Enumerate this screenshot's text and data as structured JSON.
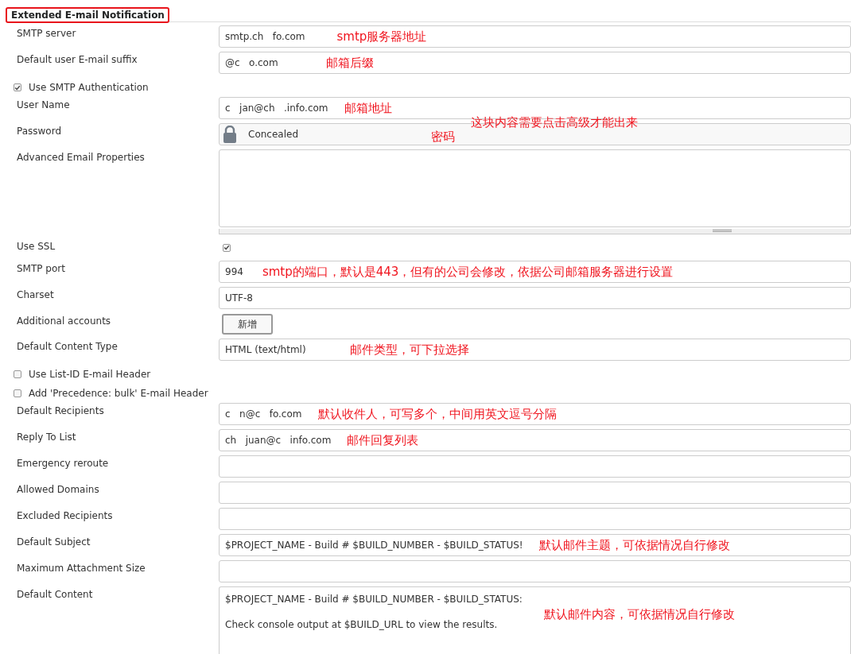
{
  "section": {
    "title": "Extended E-mail Notification"
  },
  "rows": [
    {
      "kind": "text",
      "label": "SMTP server",
      "value": "smtp.ch   fo.com",
      "note": "smtp服务器地址"
    },
    {
      "kind": "text",
      "label": "Default user E-mail suffix",
      "value": "@c   o.com",
      "note": "邮箱后缀"
    },
    {
      "kind": "checkbox",
      "label": "Use SMTP Authentication",
      "checked": true
    },
    {
      "kind": "text",
      "label": "User Name",
      "value": "c   jan@ch   .info.com",
      "note": "邮箱地址"
    },
    {
      "kind": "password",
      "label": "Password",
      "value": "Concealed",
      "note": "密码",
      "overlay_note": "这块内容需要点击高级才能出来"
    },
    {
      "kind": "textarea",
      "label": "Advanced Email Properties"
    },
    {
      "kind": "check-field",
      "label": "Use SSL",
      "checked": true
    },
    {
      "kind": "text",
      "label": "SMTP port",
      "value": "994",
      "note": "smtp的端口，默认是443，但有的公司会修改，依据公司邮箱服务器进行设置"
    },
    {
      "kind": "text",
      "label": "Charset",
      "value": "UTF-8"
    },
    {
      "kind": "button",
      "label": "Additional accounts",
      "button": "新增"
    },
    {
      "kind": "select",
      "label": "Default Content Type",
      "value": "HTML (text/html)",
      "note": "邮件类型，可下拉选择"
    },
    {
      "kind": "checkbox",
      "label": "Use List-ID E-mail Header",
      "checked": false
    },
    {
      "kind": "checkbox",
      "label": "Add 'Precedence: bulk' E-mail Header",
      "checked": false
    },
    {
      "kind": "text",
      "label": "Default Recipients",
      "value": "c   n@c   fo.com",
      "note": "默认收件人，可写多个，中间用英文逗号分隔"
    },
    {
      "kind": "text",
      "label": "Reply To List",
      "value": "ch   juan@c   info.com",
      "note": "邮件回复列表"
    },
    {
      "kind": "text",
      "label": "Emergency reroute"
    },
    {
      "kind": "text",
      "label": "Allowed Domains"
    },
    {
      "kind": "text",
      "label": "Excluded Recipients"
    },
    {
      "kind": "text",
      "label": "Default Subject",
      "value": "$PROJECT_NAME - Build # $BUILD_NUMBER - $BUILD_STATUS!",
      "note": "默认邮件主题，可依据情况自行修改"
    },
    {
      "kind": "text",
      "label": "Maximum Attachment Size"
    },
    {
      "kind": "content",
      "label": "Default Content",
      "lines": [
        "$PROJECT_NAME - Build # $BUILD_NUMBER - $BUILD_STATUS:",
        "Check console output at $BUILD_URL to view the results."
      ],
      "note": "默认邮件内容，可依据情况自行修改"
    }
  ]
}
